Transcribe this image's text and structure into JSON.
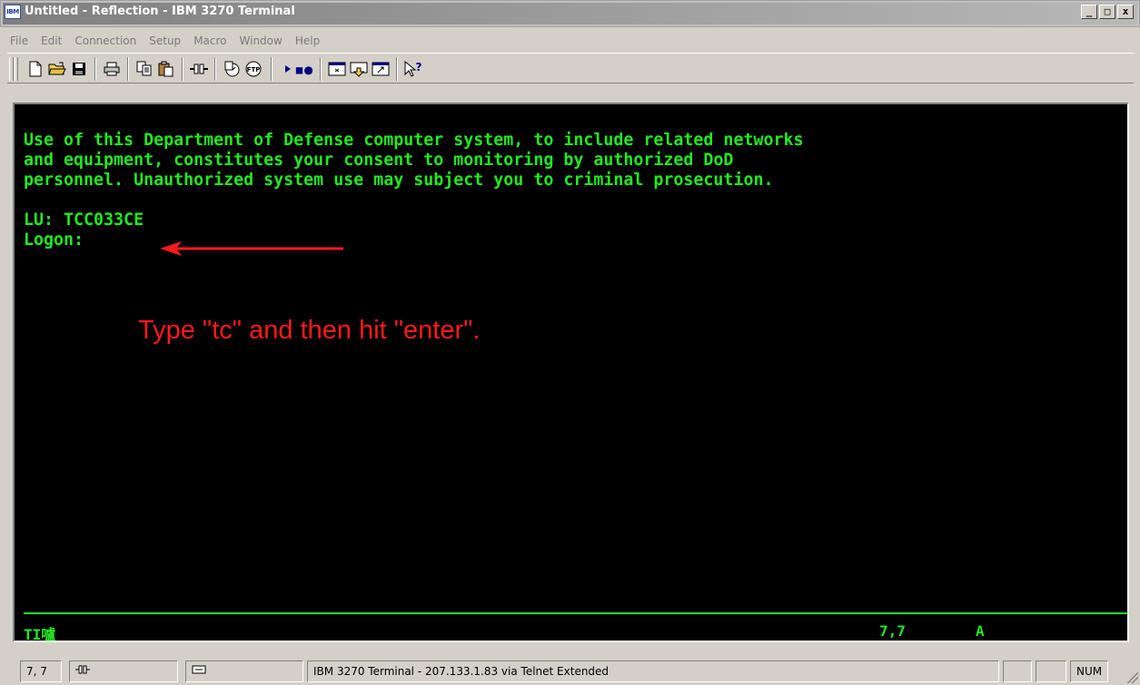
{
  "window": {
    "icon_label": "IBM",
    "title": "Untitled - Reflection - IBM 3270 Terminal",
    "minimize": "_",
    "maximize": "□",
    "close": "x"
  },
  "menu": {
    "items": [
      "File",
      "Edit",
      "Connection",
      "Setup",
      "Macro",
      "Window",
      "Help"
    ]
  },
  "toolbar": {
    "icons": [
      "new-document-icon",
      "open-folder-icon",
      "save-icon",
      "print-icon",
      "copy-icon",
      "paste-icon",
      "connect-icon",
      "session-icon",
      "ftp-icon",
      "play-macro-icon",
      "record-macro-icon",
      "screen-icon",
      "transfer-icon",
      "capture-icon",
      "context-help-icon"
    ],
    "ftp_label": "FTP"
  },
  "terminal": {
    "lines": [
      "Use of this Department of Defense computer system, to include related networks",
      "and equipment, constitutes your consent to monitoring by authorized DoD",
      "personnel. Unauthorized system use may subject you to criminal prosecution."
    ],
    "lu_line": "LU: TCC033CE",
    "logon_prompt": "Logon:",
    "instruction": "Type \"tc\" and then hit \"enter\".",
    "oia_left": "TI",
    "oia_symbol": "嚧",
    "oia_cursor": "7,7",
    "oia_mode": "A",
    "colors": {
      "text": "#22e822",
      "background": "#000000",
      "annotation": "#ff1a1a"
    }
  },
  "statusbar": {
    "cursor": "7, 7",
    "connection_text": "IBM 3270 Terminal - 207.133.1.83 via Telnet Extended",
    "num_indicator": "NUM"
  }
}
